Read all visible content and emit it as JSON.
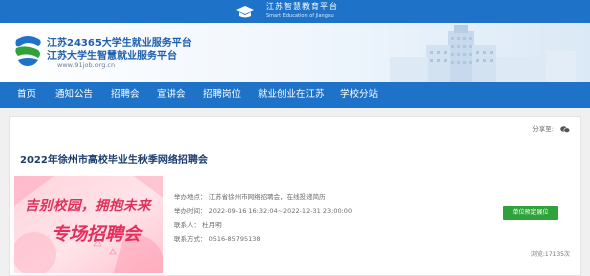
{
  "topbar": {
    "title": "江苏智慧教育平台",
    "subtitle": "Smart Education of Jiangsu"
  },
  "header": {
    "name_line1": "江苏24365大学生就业服务平台",
    "name_line2": "江苏大学生智慧就业服务平台",
    "url": "www.91job.org.cn"
  },
  "nav": {
    "items": [
      {
        "label": "首页"
      },
      {
        "label": "通知公告"
      },
      {
        "label": "招聘会"
      },
      {
        "label": "宣讲会"
      },
      {
        "label": "招聘岗位"
      },
      {
        "label": "就业创业在江苏"
      },
      {
        "label": "学校分站"
      }
    ]
  },
  "article": {
    "share_label": "分享至:",
    "share_icon": "wechat-icon",
    "title": "2022年徐州市高校毕业生秋季网络招聘会",
    "poster_text_top": "吉别校园，拥抱未来",
    "poster_text_bottom": "专场招聘会",
    "location": "举办地点： 江苏省徐州市网络招聘会，在线投递简历",
    "time": "举办时间： 2022-09-16 16:32:04~2022-12-31 23:00:00",
    "contact": "联系人： 杜月明",
    "phone": "联系方式： 0516-85795138",
    "apply_button": "单位预定展位",
    "views": "浏览:17135次"
  },
  "colors": {
    "brand_blue": "#1e73c8",
    "title_navy": "#1d3d6e",
    "button_green": "#2fa23b"
  }
}
